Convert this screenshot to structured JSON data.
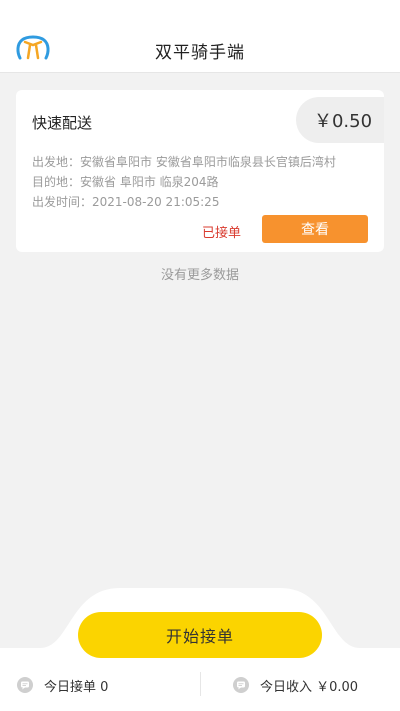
{
  "header": {
    "title": "双平骑手端",
    "logo_icon": "ribbon-logo-icon"
  },
  "order": {
    "type": "快速配送",
    "price": "￥0.50",
    "from": "出发地：安徽省阜阳市 安徽省阜阳市临泉县长官镇后湾村",
    "to": "目的地：安徽省 阜阳市  临泉204路",
    "time": "出发时间：2021-08-20 21:05:25",
    "status": "已接单",
    "view_label": "查看"
  },
  "list": {
    "no_more": "没有更多数据"
  },
  "bottom": {
    "start_label": "开始接单",
    "today_orders": "今日接单 0",
    "today_income": "今日收入 ￥0.00"
  },
  "colors": {
    "accent": "#fbd400",
    "view_button": "#f7922e",
    "status_red": "#d93b2f"
  }
}
